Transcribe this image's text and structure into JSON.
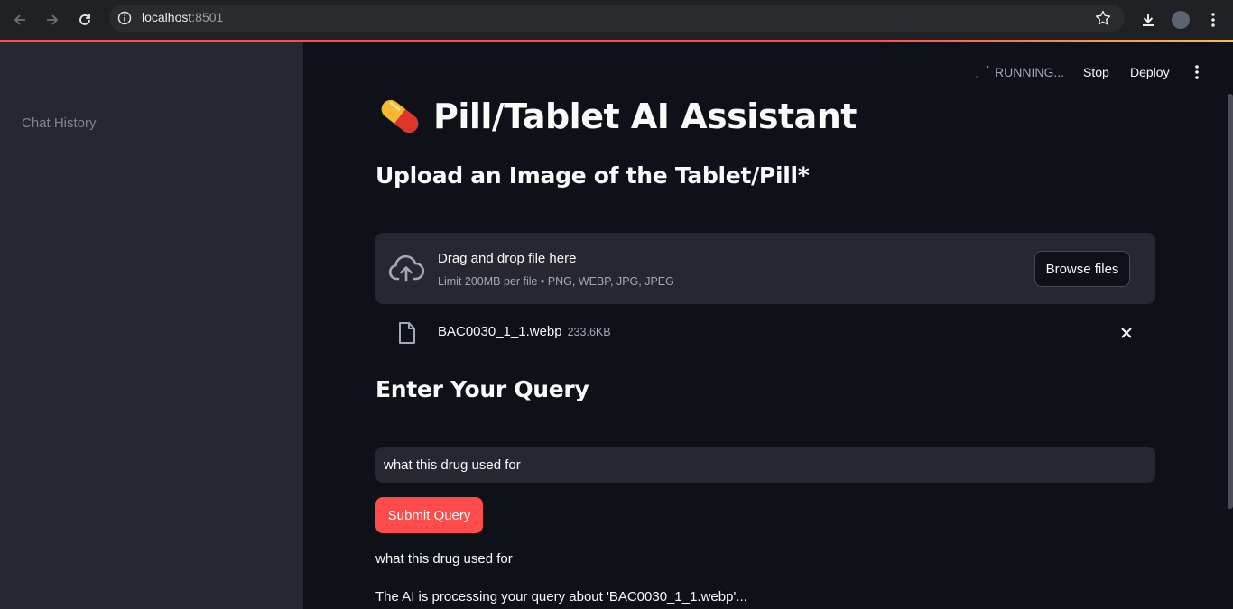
{
  "browser": {
    "url_host": "localhost",
    "url_port": ":8501",
    "icons": [
      "back-icon",
      "forward-icon",
      "reload-icon",
      "site-info-icon",
      "bookmark-star-icon",
      "download-icon",
      "profile-avatar",
      "browser-menu-icon"
    ]
  },
  "sidebar": {
    "title": "Chat History"
  },
  "topbar": {
    "status": "RUNNING...",
    "stop_label": "Stop",
    "deploy_label": "Deploy"
  },
  "page": {
    "title": "Pill/Tablet AI Assistant",
    "upload_heading": "Upload an Image of the Tablet/Pill*",
    "query_heading": "Enter Your Query"
  },
  "uploader": {
    "drag_text": "Drag and drop file here",
    "limit_text": "Limit 200MB per file • PNG, WEBP, JPG, JPEG",
    "browse_label": "Browse files",
    "file_name": "BAC0030_1_1.webp",
    "file_size": "233.6KB"
  },
  "query": {
    "value": "what this drug used for",
    "submit_label": "Submit Query",
    "echo": "what this drug used for",
    "processing": "The AI is processing your query about 'BAC0030_1_1.webp'..."
  },
  "colors": {
    "accent": "#ff4b4b",
    "background": "#0e1117",
    "secondary_bg": "#262730"
  }
}
